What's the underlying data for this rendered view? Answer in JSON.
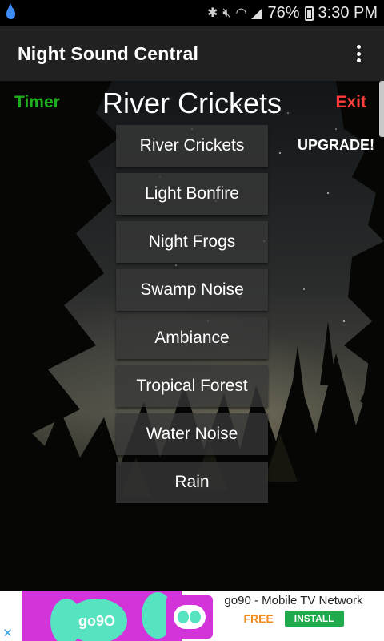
{
  "status_bar": {
    "battery": "76%",
    "time": "3:30 PM"
  },
  "app_bar": {
    "title": "Night Sound Central"
  },
  "header": {
    "timer_label": "Timer",
    "current_sound": "River Crickets",
    "exit_label": "Exit",
    "upgrade_label": "UPGRADE!"
  },
  "sounds": [
    "River Crickets",
    "Light Bonfire",
    "Night Frogs",
    "Swamp Noise",
    "Ambiance",
    "Tropical Forest",
    "Water Noise",
    "Rain"
  ],
  "ad": {
    "bubble_text": "go9O",
    "app_name": "go90 - Mobile TV Network",
    "price": "FREE",
    "install_label": "INSTALL"
  },
  "colors": {
    "timer": "#1eb01e",
    "exit": "#ff3d3d",
    "app_bar": "#212121",
    "ad_brand": "#d334d9",
    "ad_accent": "#55e3c0",
    "install": "#1faa4b"
  }
}
